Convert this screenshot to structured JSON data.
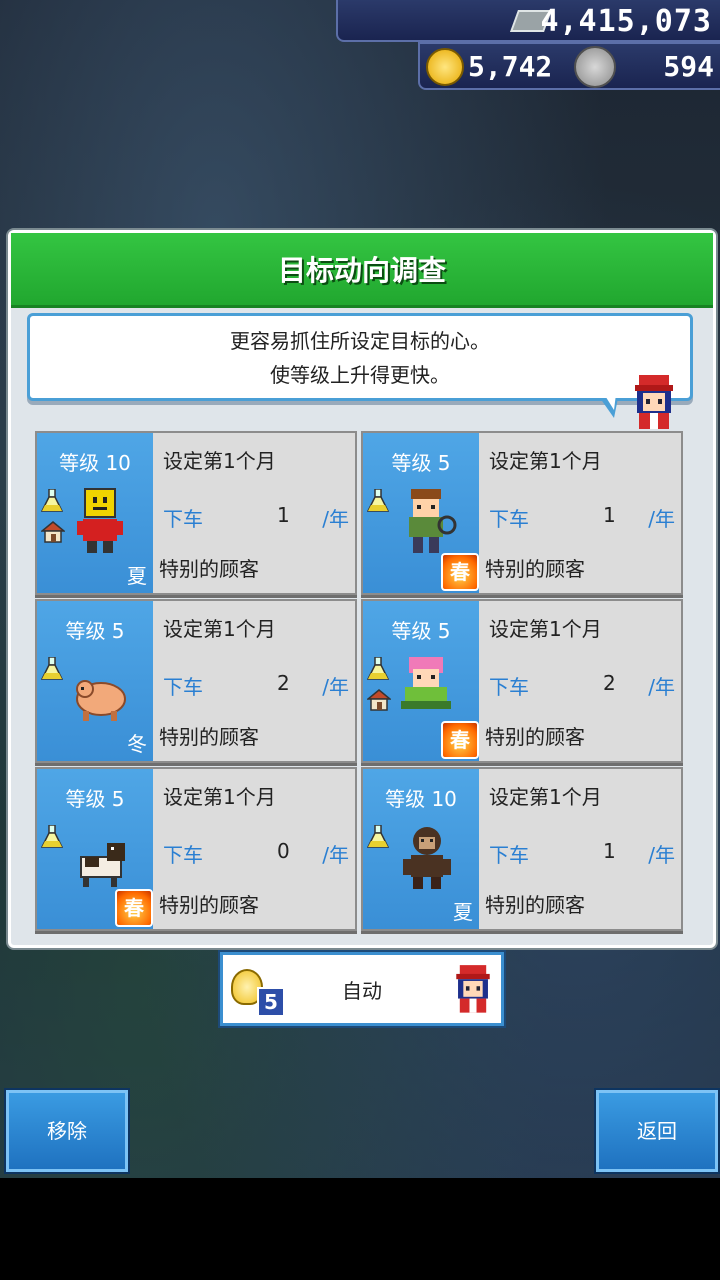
{
  "resources": {
    "money": "4,415,073",
    "research_points": "5,742",
    "medals": "594"
  },
  "panel": {
    "title": "目标动向调查",
    "description": [
      "更容易抓住所设定目标的心。",
      "使等级上升得更快。"
    ]
  },
  "cards": [
    {
      "level": "等级 10",
      "setting": "设定第1个月",
      "alight_label": "下车",
      "count": "1",
      "per_year": "/年",
      "target": "特别的顾客",
      "season": "夏",
      "season_hot": false,
      "has_house": true,
      "character": "yellow-robot"
    },
    {
      "level": "等级 5",
      "setting": "设定第1个月",
      "alight_label": "下车",
      "count": "1",
      "per_year": "/年",
      "target": "特别的顾客",
      "season": "春",
      "season_hot": true,
      "has_house": false,
      "character": "explorer"
    },
    {
      "level": "等级 5",
      "setting": "设定第1个月",
      "alight_label": "下车",
      "count": "2",
      "per_year": "/年",
      "target": "特别的顾客",
      "season": "冬",
      "season_hot": false,
      "has_house": false,
      "character": "pig"
    },
    {
      "level": "等级 5",
      "setting": "设定第1个月",
      "alight_label": "下车",
      "count": "2",
      "per_year": "/年",
      "target": "特别的顾客",
      "season": "春",
      "season_hot": true,
      "has_house": true,
      "character": "pink-hair-girl"
    },
    {
      "level": "等级 5",
      "setting": "设定第1个月",
      "alight_label": "下车",
      "count": "0",
      "per_year": "/年",
      "target": "特别的顾客",
      "season": "春",
      "season_hot": true,
      "has_house": false,
      "character": "dog"
    },
    {
      "level": "等级 10",
      "setting": "设定第1个月",
      "alight_label": "下车",
      "count": "1",
      "per_year": "/年",
      "target": "特别的顾客",
      "season": "夏",
      "season_hot": false,
      "has_house": false,
      "character": "monkey"
    }
  ],
  "auto_button": {
    "cost": "5",
    "label": "自动"
  },
  "buttons": {
    "remove": "移除",
    "back": "返回"
  },
  "colors": {
    "header_green": "#21a72f",
    "card_blue": "#3a8fd6",
    "alight_blue": "#2a7fd2"
  }
}
